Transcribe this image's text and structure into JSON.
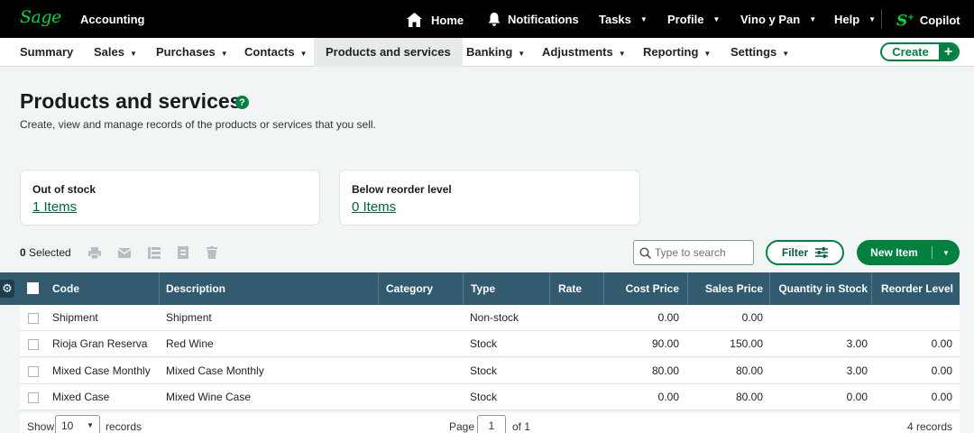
{
  "app": {
    "logo": "Sage",
    "title": "Accounting"
  },
  "topbar": {
    "home": "Home",
    "notifications": "Notifications",
    "tasks": "Tasks",
    "profile": "Profile",
    "company": "Vino y Pan",
    "help": "Help",
    "copilot": "Copilot"
  },
  "nav": {
    "items": [
      "Summary",
      "Sales",
      "Purchases",
      "Contacts",
      "Products and services",
      "Banking",
      "Adjustments",
      "Reporting",
      "Settings"
    ],
    "active": "Products and services",
    "create": "Create"
  },
  "page": {
    "title": "Products and services",
    "subtitle": "Create, view and manage records of the products or services that you sell."
  },
  "cards": [
    {
      "label": "Out of stock",
      "value": "1 Items"
    },
    {
      "label": "Below reorder level",
      "value": "0 Items"
    }
  ],
  "toolbar": {
    "selected_count": "0",
    "selected_label": "Selected",
    "search_placeholder": "Type to search",
    "filter": "Filter",
    "new_item": "New Item"
  },
  "table": {
    "columns": [
      "Code",
      "Description",
      "Category",
      "Type",
      "Rate",
      "Cost Price",
      "Sales Price",
      "Quantity in Stock",
      "Reorder Level"
    ],
    "rows": [
      {
        "code": "Shipment",
        "description": "Shipment",
        "category": "",
        "type": "Non-stock",
        "rate": "",
        "cost": "0.00",
        "sales": "0.00",
        "qty": "",
        "reorder": ""
      },
      {
        "code": "Rioja Gran Reserva",
        "description": "Red Wine",
        "category": "",
        "type": "Stock",
        "rate": "",
        "cost": "90.00",
        "sales": "150.00",
        "qty": "3.00",
        "reorder": "0.00"
      },
      {
        "code": "Mixed Case Monthly",
        "description": "Mixed Case Monthly",
        "category": "",
        "type": "Stock",
        "rate": "",
        "cost": "80.00",
        "sales": "80.00",
        "qty": "3.00",
        "reorder": "0.00"
      },
      {
        "code": "Mixed Case",
        "description": "Mixed Wine Case",
        "category": "",
        "type": "Stock",
        "rate": "",
        "cost": "0.00",
        "sales": "80.00",
        "qty": "0.00",
        "reorder": "0.00"
      }
    ]
  },
  "footer": {
    "show": "Show",
    "page_size": "10",
    "records": "records",
    "page": "Page",
    "page_num": "1",
    "of": "of 1",
    "total": "4 records"
  },
  "colors": {
    "brand": "#00d639",
    "primary": "#00813f",
    "table_header": "#335b70",
    "topbar": "#000000"
  },
  "icons": [
    "home-icon",
    "bell-icon",
    "copilot-icon",
    "help-icon",
    "print-icon",
    "email-icon",
    "columns-icon",
    "document-icon",
    "trash-icon",
    "search-icon",
    "sliders-icon",
    "gear-icon"
  ]
}
